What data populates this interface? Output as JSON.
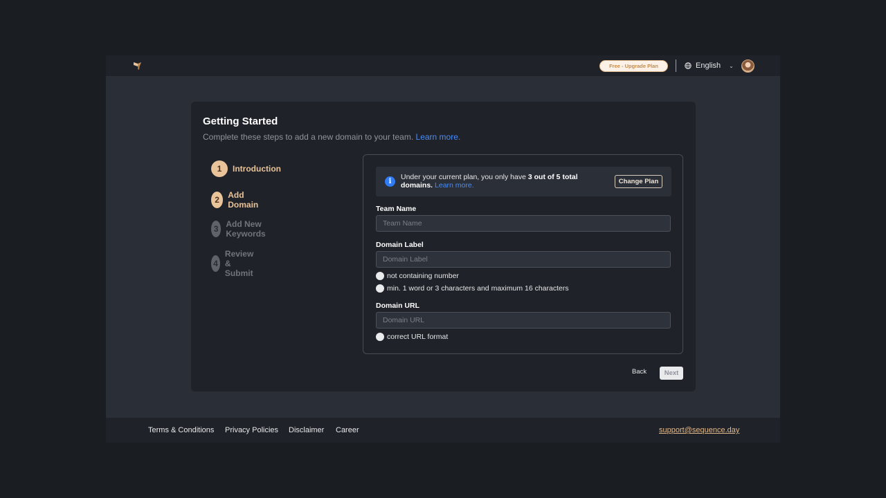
{
  "header": {
    "upgrade_label": "Free - Upgrade Plan",
    "language": "English",
    "logo_icon": "sequence-logo-icon",
    "globe_icon": "globe-icon",
    "chevron_icon": "chevron-down-icon"
  },
  "card": {
    "title": "Getting Started",
    "subtitle": "Complete these steps to add a new domain to your team.",
    "learn_more": "Learn more."
  },
  "steps": [
    {
      "number": "1",
      "label": "Introduction",
      "state": "active"
    },
    {
      "number": "2",
      "label": "Add Domain",
      "state": "active"
    },
    {
      "number": "3",
      "label": "Add New Keywords",
      "state": "inactive"
    },
    {
      "number": "4",
      "label": "Review & Submit",
      "state": "inactive"
    }
  ],
  "notice": {
    "text_prefix": "Under your current plan, you only have ",
    "text_bold": "3 out of 5 total domains.",
    "link": "Learn more.",
    "change_plan": "Change Plan"
  },
  "form": {
    "team_name": {
      "label": "Team Name",
      "placeholder": "Team Name",
      "value": ""
    },
    "domain_label": {
      "label": "Domain Label",
      "placeholder": "Domain Label",
      "value": ""
    },
    "domain_label_rules": [
      "not containing number",
      "min. 1 word or 3 characters and maximum 16 characters"
    ],
    "domain_url": {
      "label": "Domain URL",
      "placeholder": "Domain URL",
      "value": ""
    },
    "domain_url_rules": [
      "correct URL format"
    ]
  },
  "actions": {
    "back": "Back",
    "next": "Next"
  },
  "footer": {
    "links": [
      "Terms & Conditions",
      "Privacy Policies",
      "Disclaimer",
      "Career"
    ],
    "support_email": "support@sequence.day"
  },
  "colors": {
    "accent": "#e9c39a",
    "link": "#4a8df6",
    "background": "#1a1d22",
    "panel": "#1f2228"
  }
}
